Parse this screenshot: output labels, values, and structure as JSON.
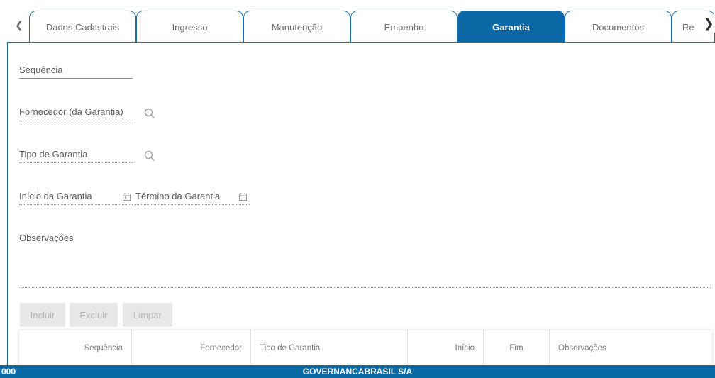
{
  "tabs": [
    {
      "label": "Dados Cadastrais"
    },
    {
      "label": "Ingresso"
    },
    {
      "label": "Manutenção"
    },
    {
      "label": "Empenho"
    },
    {
      "label": "Garantia"
    },
    {
      "label": "Documentos"
    },
    {
      "label": "Re"
    }
  ],
  "active_tab": "Garantia",
  "form": {
    "sequencia_label": "Sequência",
    "fornecedor_label": "Fornecedor (da Garantia)",
    "tipo_label": "Tipo de Garantia",
    "inicio_label": "Início da Garantia",
    "termino_label": "Término da Garantia",
    "observacoes_label": "Observações"
  },
  "buttons": {
    "incluir": "Incluir",
    "excluir": "Excluir",
    "limpar": "Limpar"
  },
  "grid": {
    "columns": [
      "Sequência",
      "Fornecedor",
      "Tipo de Garantia",
      "Início",
      "Fim",
      "Observações"
    ]
  },
  "footer": {
    "code": "000",
    "company": "GOVERNANCABRASIL S/A"
  },
  "colors": {
    "accent": "#0b68a4",
    "footer": "#0a6aa6"
  },
  "icons": {
    "tab_prev": "chevron-left-icon",
    "tab_next": "chevron-right-icon",
    "lookup": "search-icon",
    "date": "calendar-icon"
  }
}
